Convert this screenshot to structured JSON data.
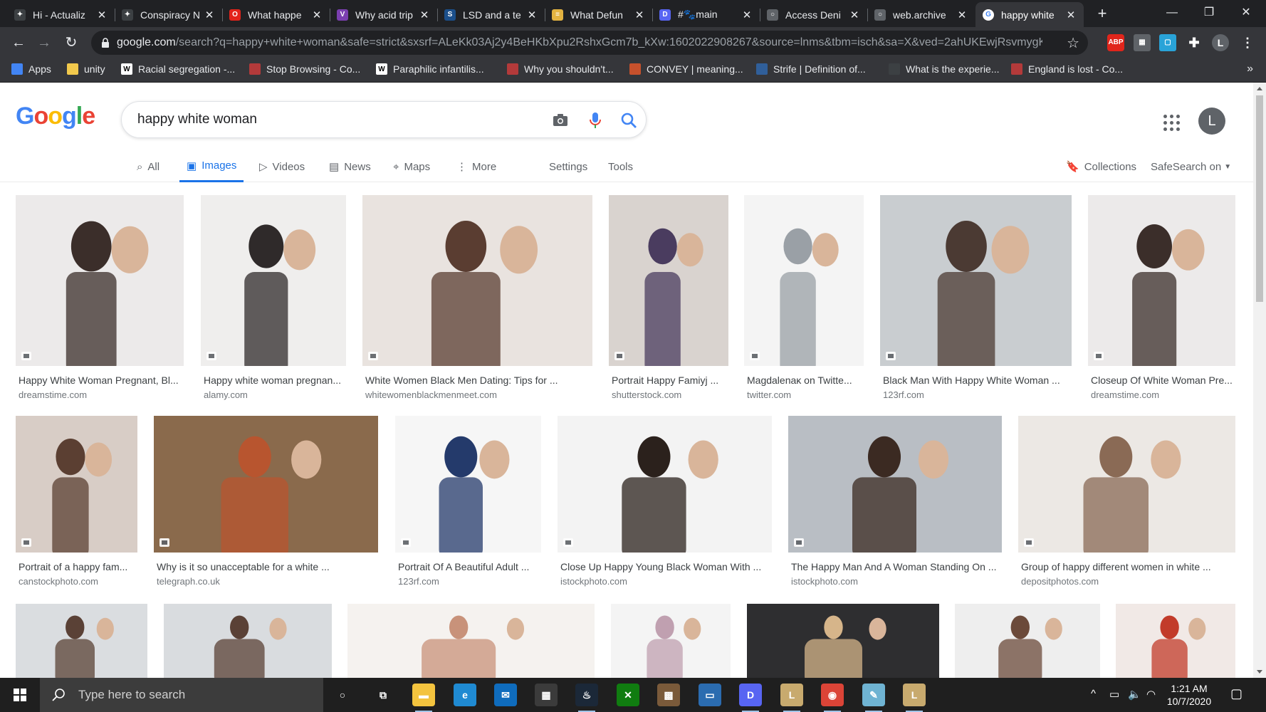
{
  "browser": {
    "tabs": [
      {
        "title": "Hi - Actualiz",
        "icon": "cursor-app-icon",
        "color": "#3c4043",
        "letter": "✦"
      },
      {
        "title": "Conspiracy N",
        "icon": "cursor-app-icon",
        "color": "#3c4043",
        "letter": "✦"
      },
      {
        "title": "What happe",
        "icon": "opera-icon",
        "color": "#e2231a",
        "letter": "O"
      },
      {
        "title": "Why acid trip",
        "icon": "vice-icon",
        "color": "#7b3fb0",
        "letter": "V"
      },
      {
        "title": "LSD and a te",
        "icon": "s-icon",
        "color": "#1b4f8b",
        "letter": "S"
      },
      {
        "title": "What Defun",
        "icon": "document-icon",
        "color": "#e3b341",
        "letter": "≡"
      },
      {
        "title": "#🐾main",
        "icon": "discord-icon",
        "color": "#5865f2",
        "letter": "D"
      },
      {
        "title": "Access Deni",
        "icon": "globe-icon",
        "color": "#5f6368",
        "letter": "○"
      },
      {
        "title": "web.archive",
        "icon": "globe-icon",
        "color": "#5f6368",
        "letter": "○"
      },
      {
        "title": "happy white",
        "icon": "google-icon",
        "color": "#ffffff",
        "letter": "G",
        "active": true
      }
    ],
    "url_host": "google.com",
    "url_rest": "/search?q=happy+white+woman&safe=strict&sxsrf=ALeKk03Aj2y4BeHKbXpu2RshxGcm7b_kXw:1602022908267&source=lnms&tbm=isch&sa=X&ved=2ahUKEwjRsvmygK...",
    "avatar_letter": "L",
    "bookmarks": [
      {
        "label": "Apps",
        "icon": "apps-icon",
        "color": "#4285f4"
      },
      {
        "label": "unity",
        "icon": "folder-icon",
        "color": "#f2c94c"
      },
      {
        "label": "Racial segregation -...",
        "icon": "wikipedia-icon",
        "color": "#ffffff"
      },
      {
        "label": "Stop Browsing - Co...",
        "icon": "cursor-app-icon",
        "color": "#b33a3a"
      },
      {
        "label": "Paraphilic infantilis...",
        "icon": "wikipedia-icon",
        "color": "#ffffff"
      },
      {
        "label": "Why you shouldn't...",
        "icon": "cursor-app-icon",
        "color": "#b33a3a"
      },
      {
        "label": "CONVEY | meaning...",
        "icon": "dictionary-icon",
        "color": "#c7512c"
      },
      {
        "label": "Strife | Definition of...",
        "icon": "merriam-icon",
        "color": "#305f9a"
      },
      {
        "label": "What is the experie...",
        "icon": "cursor-app-icon",
        "color": "#3c4043"
      },
      {
        "label": "England is lost - Co...",
        "icon": "cursor-app-icon",
        "color": "#b33a3a"
      }
    ],
    "bookmarks_more": "»"
  },
  "search": {
    "logo_letters": [
      "G",
      "o",
      "o",
      "g",
      "l",
      "e"
    ],
    "query": "happy white woman",
    "avatar_letter": "L",
    "tabs": [
      {
        "label": "All",
        "icon": "search-icon",
        "glyph": "⌕"
      },
      {
        "label": "Images",
        "icon": "image-icon",
        "glyph": "▣",
        "active": true
      },
      {
        "label": "Videos",
        "icon": "video-icon",
        "glyph": "▷"
      },
      {
        "label": "News",
        "icon": "news-icon",
        "glyph": "▤"
      },
      {
        "label": "Maps",
        "icon": "map-pin-icon",
        "glyph": "⌖"
      },
      {
        "label": "More",
        "icon": "more-vert-icon",
        "glyph": "⋮"
      }
    ],
    "settings_label": "Settings",
    "tools_label": "Tools",
    "collections_label": "Collections",
    "safesearch_label": "SafeSearch on"
  },
  "results": [
    {
      "caption": "Happy White Woman Pregnant, Bl...",
      "source": "dreamstime.com",
      "bg": "#eceaea",
      "fg": "#3b2e2a"
    },
    {
      "caption": "Happy white woman pregnan...",
      "source": "alamy.com",
      "bg": "#efeeed",
      "fg": "#2f2a2a"
    },
    {
      "caption": "White Women Black Men Dating: Tips for ...",
      "source": "whitewomenblackmenmeet.com",
      "bg": "#e9e3df",
      "fg": "#5a3d31"
    },
    {
      "caption": "Portrait Happy Famiyj ...",
      "source": "shutterstock.com",
      "bg": "#d9d3cf",
      "fg": "#4a3c5f"
    },
    {
      "caption": "Magdalenaĸ on Twitte...",
      "source": "twitter.com",
      "bg": "#f4f4f4",
      "fg": "#9aa0a6"
    },
    {
      "caption": "Black Man With Happy White Woman ...",
      "source": "123rf.com",
      "bg": "#c9cdd0",
      "fg": "#4b3a33"
    },
    {
      "caption": "Closeup Of White Woman Pre...",
      "source": "dreamstime.com",
      "bg": "#eceaea",
      "fg": "#3b2e2a"
    },
    {
      "caption": "Portrait of a happy fam...",
      "source": "canstockphoto.com",
      "bg": "#d8cdc6",
      "fg": "#5b3f32"
    },
    {
      "caption": "Why is it so unacceptable for a white ...",
      "source": "telegraph.co.uk",
      "bg": "#8a6a4c",
      "fg": "#b8552f"
    },
    {
      "caption": "Portrait Of A Beautiful Adult ...",
      "source": "123rf.com",
      "bg": "#f6f6f6",
      "fg": "#243a6b"
    },
    {
      "caption": "Close Up Happy Young Black Woman With ...",
      "source": "istockphoto.com",
      "bg": "#f3f3f3",
      "fg": "#2b211c"
    },
    {
      "caption": "The Happy Man And A Woman Standing On ...",
      "source": "istockphoto.com",
      "bg": "#b9bec4",
      "fg": "#3b2a22"
    },
    {
      "caption": "Group of happy different women in white ...",
      "source": "depositphotos.com",
      "bg": "#ece8e4",
      "fg": "#8a6a55"
    },
    {
      "caption": "",
      "source": "",
      "bg": "#dadde0",
      "fg": "#5a4136"
    },
    {
      "caption": "",
      "source": "",
      "bg": "#d9dcdf",
      "fg": "#5a4136"
    },
    {
      "caption": "",
      "source": "",
      "bg": "#f5f2ef",
      "fg": "#c8927a"
    },
    {
      "caption": "",
      "source": "",
      "bg": "#f4f4f4",
      "fg": "#c0a0b0"
    },
    {
      "caption": "",
      "source": "",
      "bg": "#2e2e30",
      "fg": "#d6b58a"
    },
    {
      "caption": "",
      "source": "",
      "bg": "#eeeeee",
      "fg": "#6b4a3a"
    },
    {
      "caption": "",
      "source": "",
      "bg": "#f1e9e6",
      "fg": "#c23b2a"
    }
  ],
  "taskbar": {
    "search_placeholder": "Type here to search",
    "time": "1:21 AM",
    "date": "10/7/2020",
    "apps": [
      {
        "name": "cortana-icon",
        "color": "transparent",
        "glyph": "○"
      },
      {
        "name": "task-view-icon",
        "color": "transparent",
        "glyph": "⧉"
      },
      {
        "name": "file-explorer-icon",
        "color": "#f3c33e",
        "glyph": "▬"
      },
      {
        "name": "edge-icon",
        "color": "#1f8ad2",
        "glyph": "e"
      },
      {
        "name": "mail-icon",
        "color": "#0f6cbd",
        "glyph": "✉"
      },
      {
        "name": "store-icon",
        "color": "#3b3b3b",
        "glyph": "▦"
      },
      {
        "name": "steam-icon",
        "color": "#1b2838",
        "glyph": "♨"
      },
      {
        "name": "xbox-icon",
        "color": "#107c10",
        "glyph": "✕"
      },
      {
        "name": "game-icon",
        "color": "#7a5a3a",
        "glyph": "▩"
      },
      {
        "name": "window-app-icon",
        "color": "#2b6cb0",
        "glyph": "▭"
      },
      {
        "name": "discord-icon",
        "color": "#5865f2",
        "glyph": "D"
      },
      {
        "name": "league-icon",
        "color": "#c8aa6e",
        "glyph": "L"
      },
      {
        "name": "chrome-icon",
        "color": "#db4437",
        "glyph": "◉"
      },
      {
        "name": "notepad-icon",
        "color": "#6fb3d2",
        "glyph": "✎"
      },
      {
        "name": "league-client-icon",
        "color": "#c8aa6e",
        "glyph": "L"
      }
    ]
  }
}
